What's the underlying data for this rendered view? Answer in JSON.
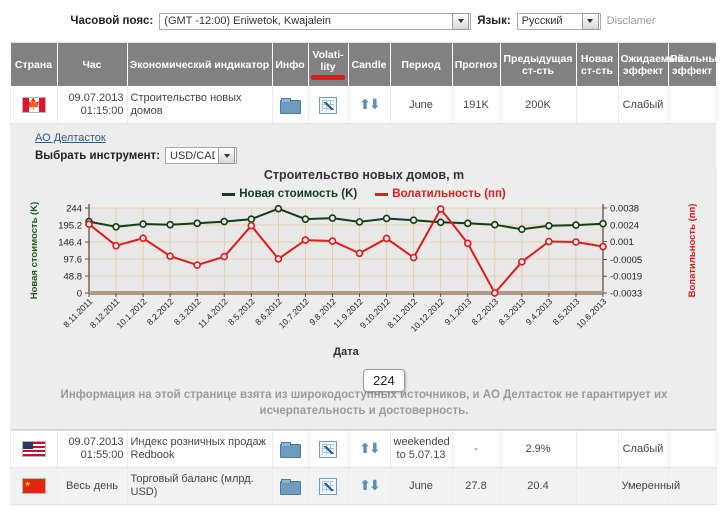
{
  "topbar": {
    "timezone_label": "Часовой пояс:",
    "timezone_value": "(GMT -12:00) Eniwetok, Kwajalein",
    "language_label": "Язык:",
    "language_value": "Русский",
    "disclamer": "Disclamer"
  },
  "table": {
    "headers": [
      "Страна",
      "Час",
      "Экономический индикатор",
      "Инфо",
      "Volati-lity",
      "Candle",
      "Период",
      "Прогноз",
      "Предыдущая ст-сть",
      "Новая ст-сть",
      "Ожидаемый эффект",
      "Реальный эффект"
    ],
    "header_volatility_line1": "Volati-",
    "header_volatility_line2": "lity",
    "rows": [
      {
        "flag": "flag-canada",
        "time": "09.07.2013 01:15:00",
        "time_line1": "09.07.2013",
        "time_line2": "01:15:00",
        "indicator": "Строительство новых домов",
        "period": "June",
        "forecast": "191K",
        "previous": "200K",
        "new_value": "",
        "expected_effect": "Слабый",
        "real_effect": ""
      },
      {
        "flag": "flag-usa",
        "time_line1": "09.07.2013",
        "time_line2": "01:55:00",
        "indicator": "Индекс розничных продаж Redbook",
        "period_line1": "weekended",
        "period_line2": "to 5.07.13",
        "forecast": "-",
        "previous": "2.9%",
        "new_value": "",
        "expected_effect": "Слабый",
        "real_effect": ""
      },
      {
        "flag": "flag-china",
        "time_all_day": "Весь день",
        "indicator": "Торговый баланс (млрд. USD)",
        "period": "June",
        "forecast": "27.8",
        "previous": "20.4",
        "new_value": "",
        "expected_effect": "Умеренный",
        "real_effect": ""
      }
    ]
  },
  "panel": {
    "company_link": "АО Делтасток",
    "instrument_label": "Выбрать инструмент:",
    "instrument_value": "USD/CAD",
    "tooltip_value": "224",
    "footnote": "Информация на этой странице взята из широкодоступных источников, и АО Делтасток не гарантирует их исчерпательность и достоверность."
  },
  "chart_data": {
    "type": "line",
    "title": "Строительство новых домов, m",
    "xlabel": "Дата",
    "ylabel": "Новая стоимость (K)",
    "y2label": "Волатильность (пп)",
    "grid": true,
    "legend_position": "top-center",
    "categories": [
      "8.11.2011",
      "8.12.2011",
      "10.1.2012",
      "8.2.2012",
      "8.3.2012",
      "11.4.2012",
      "8.5.2012",
      "8.6.2012",
      "10.7.2012",
      "9.8.2012",
      "11.9.2012",
      "9.10.2012",
      "8.11.2012",
      "10.12.2012",
      "9.1.2013",
      "8.2.2013",
      "8.3.2013",
      "9.4.2013",
      "8.5.2013",
      "10.6.2013"
    ],
    "yticks": [
      244,
      195.2,
      146.4,
      97.6,
      48.8,
      0
    ],
    "ylim": [
      0,
      244
    ],
    "y2ticks": [
      0.0038,
      0.0024,
      0.001,
      -0.0005,
      -0.0019,
      -0.0033
    ],
    "y2lim": [
      -0.0033,
      0.0038
    ],
    "series": [
      {
        "name": "Новая стоимость (K)",
        "color": "#123d16",
        "axis": "left",
        "values": [
          205,
          190,
          198,
          196,
          200,
          205,
          212,
          242,
          212,
          215,
          204,
          214,
          209,
          203,
          200,
          196,
          183,
          193,
          195,
          199
        ]
      },
      {
        "name": "Волатильность (пп)",
        "color": "#e01b1b",
        "axis": "right",
        "values": [
          0.00245,
          0.00065,
          0.00128,
          -0.00022,
          -0.00097,
          -0.00026,
          0.00232,
          -0.00045,
          0.00112,
          0.00104,
          2e-05,
          0.00126,
          -0.00034,
          0.00372,
          0.00085,
          -0.0033,
          -0.0007,
          0.001,
          0.00096,
          0.00058
        ]
      }
    ]
  }
}
